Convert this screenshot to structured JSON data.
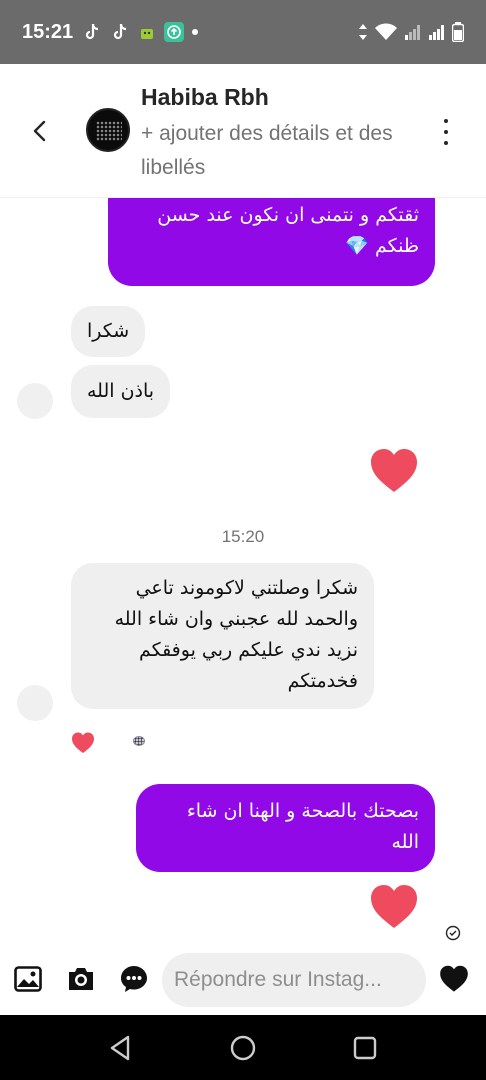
{
  "status_bar": {
    "time": "15:21",
    "icons_left": [
      "tiktok-icon",
      "tiktok-icon",
      "android-icon",
      "upload-app-icon",
      "dot-icon"
    ],
    "icons_right": [
      "data-arrows-icon",
      "wifi-icon",
      "signal-icon",
      "signal-icon",
      "battery-icon"
    ]
  },
  "header": {
    "name": "Habiba Rbh",
    "subtitle": "+ ajouter des détails et des libellés",
    "back_icon": "chevron-left-icon",
    "more_icon": "vertical-ellipsis-icon"
  },
  "messages": {
    "m1": {
      "direction": "out",
      "lines": [
        "ثقتكم و نتمنى ان نكون عند حسن",
        "ظنكم 💎"
      ],
      "partial_line": "..."
    },
    "m2": {
      "direction": "in",
      "text": "شكرا"
    },
    "m3": {
      "direction": "in",
      "text": "باذن الله"
    },
    "m4": {
      "direction": "out",
      "type": "heart"
    },
    "timestamp": "15:20",
    "m5": {
      "direction": "in",
      "lines": [
        "شكرا وصلتني لاكوموند تاعي",
        "والحمد لله عجبني وان شاء الله",
        "نزيد ندي عليكم ربي يوفقكم",
        "فخدمتكم"
      ],
      "reaction": "heart",
      "reaction_user": "avatar"
    },
    "m6": {
      "direction": "out",
      "lines": [
        "بصحتك بالصحة و الهنا ان شاء",
        "الله"
      ]
    },
    "m7": {
      "direction": "out",
      "type": "heart",
      "status": "seen-check-icon"
    }
  },
  "composer": {
    "placeholder": "Répondre sur Instag...",
    "icons": [
      "gallery-icon",
      "camera-icon",
      "chat-sticker-icon",
      "heart-icon"
    ]
  },
  "nav": {
    "buttons": [
      "back-triangle-icon",
      "home-circle-icon",
      "recents-square-icon"
    ]
  },
  "colors": {
    "accent": "#9009e6",
    "heart": "#ef4b5e",
    "incoming": "#efefef"
  }
}
